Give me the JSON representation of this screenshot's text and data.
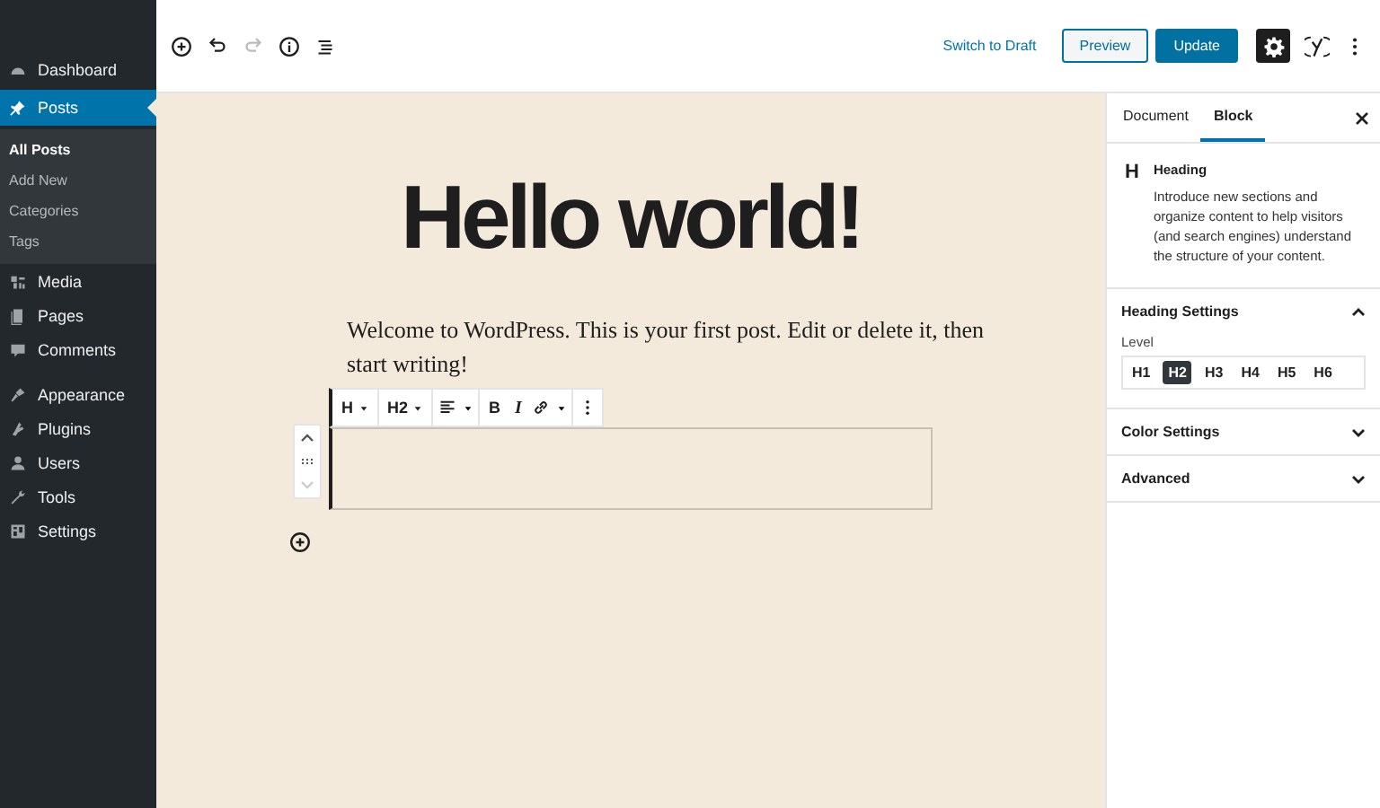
{
  "sidebar": {
    "items": [
      {
        "label": "Dashboard",
        "selected": false
      },
      {
        "label": "Posts",
        "selected": true,
        "children": [
          {
            "label": "All Posts",
            "selected": true
          },
          {
            "label": "Add New",
            "selected": false
          },
          {
            "label": "Categories",
            "selected": false
          },
          {
            "label": "Tags",
            "selected": false
          }
        ]
      },
      {
        "label": "Media",
        "selected": false
      },
      {
        "label": "Pages",
        "selected": false
      },
      {
        "label": "Comments",
        "selected": false
      },
      {
        "label": "Appearance",
        "selected": false
      },
      {
        "label": "Plugins",
        "selected": false
      },
      {
        "label": "Users",
        "selected": false
      },
      {
        "label": "Tools",
        "selected": false
      },
      {
        "label": "Settings",
        "selected": false
      }
    ]
  },
  "top_bar": {
    "redo_disabled": true,
    "switch_to_draft": "Switch to Draft",
    "preview": "Preview",
    "update": "Update",
    "settings_selected": true
  },
  "editor": {
    "title": "Hello world!",
    "paragraph": "Welcome to WordPress. This is your first post. Edit or delete it, then start writing!",
    "block_toolbar": {
      "block_type": "H",
      "heading_level": "H2",
      "bold": "B",
      "italic": "I"
    },
    "mover": {
      "up_disabled": false,
      "down_disabled": true
    }
  },
  "panel": {
    "tabs": [
      {
        "label": "Document",
        "selected": false
      },
      {
        "label": "Block",
        "selected": true
      }
    ],
    "block": {
      "icon": "H",
      "name": "Heading",
      "description": "Introduce new sections and organize content to help visitors (and search engines) understand the structure of your content."
    },
    "sections": [
      {
        "title": "Heading Settings",
        "expanded": true,
        "level_label": "Level",
        "levels": [
          {
            "label": "H1",
            "selected": false
          },
          {
            "label": "H2",
            "selected": true
          },
          {
            "label": "H3",
            "selected": false
          },
          {
            "label": "H4",
            "selected": false
          },
          {
            "label": "H5",
            "selected": false
          },
          {
            "label": "H6",
            "selected": false
          }
        ]
      },
      {
        "title": "Color Settings",
        "expanded": false
      },
      {
        "title": "Advanced",
        "expanded": false
      }
    ]
  }
}
